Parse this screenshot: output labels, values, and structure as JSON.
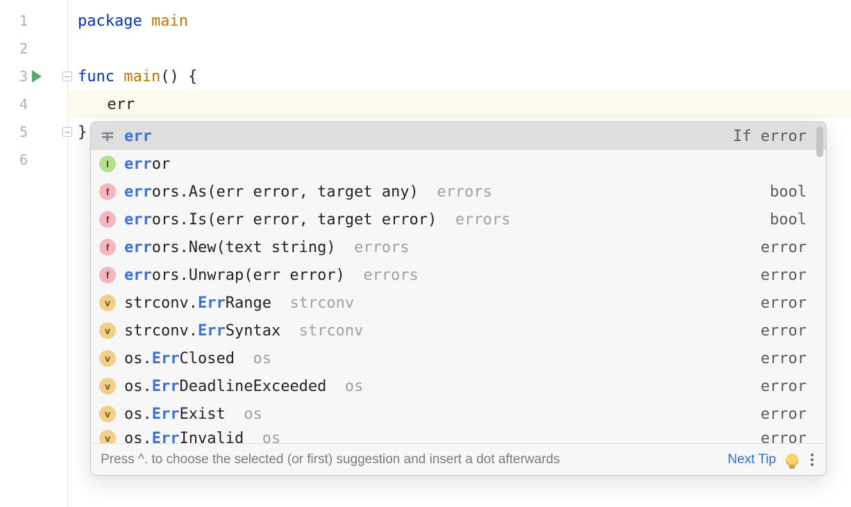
{
  "code": {
    "lines": [
      "1",
      "2",
      "3",
      "4",
      "5",
      "6"
    ],
    "pkg_kw": "package",
    "pkg_name": "main",
    "func_kw": "func",
    "func_name": "main",
    "func_paren": "()",
    "brace_open": "{",
    "typed": "err",
    "brace_close": "}"
  },
  "popup": {
    "hint_prefix": "Press ",
    "hint_key": "^",
    "hint_rest": ". to choose the selected (or first) suggestion and insert a dot afterwards",
    "next_tip": "Next Tip",
    "items": [
      {
        "icon": "template",
        "hl": "err",
        "rest": "",
        "pkg": "",
        "right": "If error",
        "selected": true
      },
      {
        "icon": "interface",
        "hl": "err",
        "rest": "or",
        "pkg": "",
        "right": ""
      },
      {
        "icon": "func",
        "hl": "err",
        "rest": "ors.As(err error, target any)",
        "pkg": "errors",
        "right": "bool"
      },
      {
        "icon": "func",
        "hl": "err",
        "rest": "ors.Is(err error, target error)",
        "pkg": "errors",
        "right": "bool"
      },
      {
        "icon": "func",
        "hl": "err",
        "rest": "ors.New(text string)",
        "pkg": "errors",
        "right": "error"
      },
      {
        "icon": "func",
        "hl": "err",
        "rest": "ors.Unwrap(err error)",
        "pkg": "errors",
        "right": "error"
      },
      {
        "icon": "var",
        "pre": "strconv.",
        "hl": "Err",
        "rest": "Range",
        "pkg": "strconv",
        "right": "error"
      },
      {
        "icon": "var",
        "pre": "strconv.",
        "hl": "Err",
        "rest": "Syntax",
        "pkg": "strconv",
        "right": "error"
      },
      {
        "icon": "var",
        "pre": "os.",
        "hl": "Err",
        "rest": "Closed",
        "pkg": "os",
        "right": "error"
      },
      {
        "icon": "var",
        "pre": "os.",
        "hl": "Err",
        "rest": "DeadlineExceeded",
        "pkg": "os",
        "right": "error"
      },
      {
        "icon": "var",
        "pre": "os.",
        "hl": "Err",
        "rest": "Exist",
        "pkg": "os",
        "right": "error"
      },
      {
        "icon": "var",
        "pre": "os.",
        "hl": "Err",
        "rest": "Invalid",
        "pkg": "os",
        "right": "error",
        "cut": true
      }
    ],
    "icon_letters": {
      "interface": "I",
      "func": "f",
      "var": "v"
    }
  }
}
